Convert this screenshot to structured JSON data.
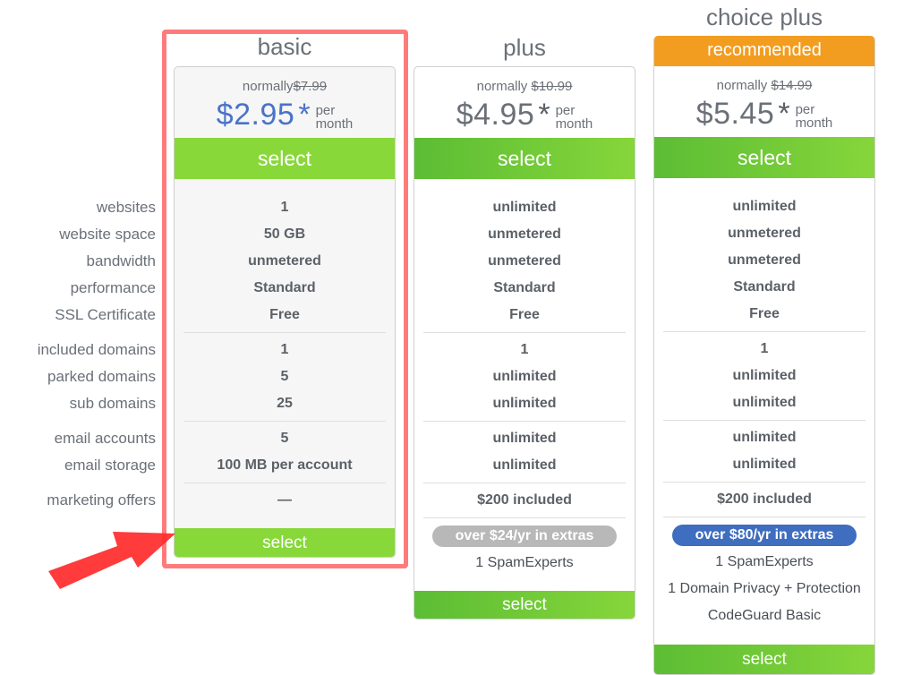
{
  "row_labels": [
    "websites",
    "website space",
    "bandwidth",
    "performance",
    "SSL Certificate",
    "included domains",
    "parked domains",
    "sub domains",
    "email accounts",
    "email storage",
    "marketing offers"
  ],
  "plans": [
    {
      "name": "basic",
      "normally_label": "normally",
      "normal_price": "$7.99",
      "price": "$2.95",
      "asterisk": "*",
      "per_line1": "per",
      "per_line2": "month",
      "select_top_label": "select",
      "select_bottom_label": "select",
      "values": [
        "1",
        "50 GB",
        "unmetered",
        "Standard",
        "Free",
        "1",
        "5",
        "25",
        "5",
        "100 MB per account",
        "—"
      ],
      "highlighted": true
    },
    {
      "name": "plus",
      "normally_label": "normally",
      "normal_price": "$10.99",
      "price": "$4.95",
      "asterisk": "*",
      "per_line1": "per",
      "per_line2": "month",
      "select_top_label": "select",
      "select_bottom_label": "select",
      "values": [
        "unlimited",
        "unmetered",
        "unmetered",
        "Standard",
        "Free",
        "1",
        "unlimited",
        "unlimited",
        "unlimited",
        "unlimited",
        "$200 included"
      ],
      "extras_badge": "over $24/yr in extras",
      "extras": [
        "1 SpamExperts"
      ]
    },
    {
      "name": "choice plus",
      "badge": "recommended",
      "normally_label": "normally",
      "normal_price": "$14.99",
      "price": "$5.45",
      "asterisk": "*",
      "per_line1": "per",
      "per_line2": "month",
      "select_top_label": "select",
      "select_bottom_label": "select",
      "values": [
        "unlimited",
        "unmetered",
        "unmetered",
        "Standard",
        "Free",
        "1",
        "unlimited",
        "unlimited",
        "unlimited",
        "unlimited",
        "$200 included"
      ],
      "extras_badge": "over $80/yr in extras",
      "extras": [
        "1 SpamExperts",
        "1 Domain Privacy + Protection",
        "CodeGuard Basic"
      ]
    }
  ],
  "colors": {
    "select_green": "#88d83a",
    "recommended_orange": "#f29d1f",
    "price_blue": "#4a73c8",
    "extras_gray": "#b8b8b8",
    "extras_blue": "#3f6dbf",
    "highlight_red": "#ff7b7b",
    "arrow_red": "#ff2a2a"
  },
  "annotations": {
    "highlight": "red-frame-around-basic-plan",
    "arrow": "red-arrow-pointing-to-basic-select"
  }
}
